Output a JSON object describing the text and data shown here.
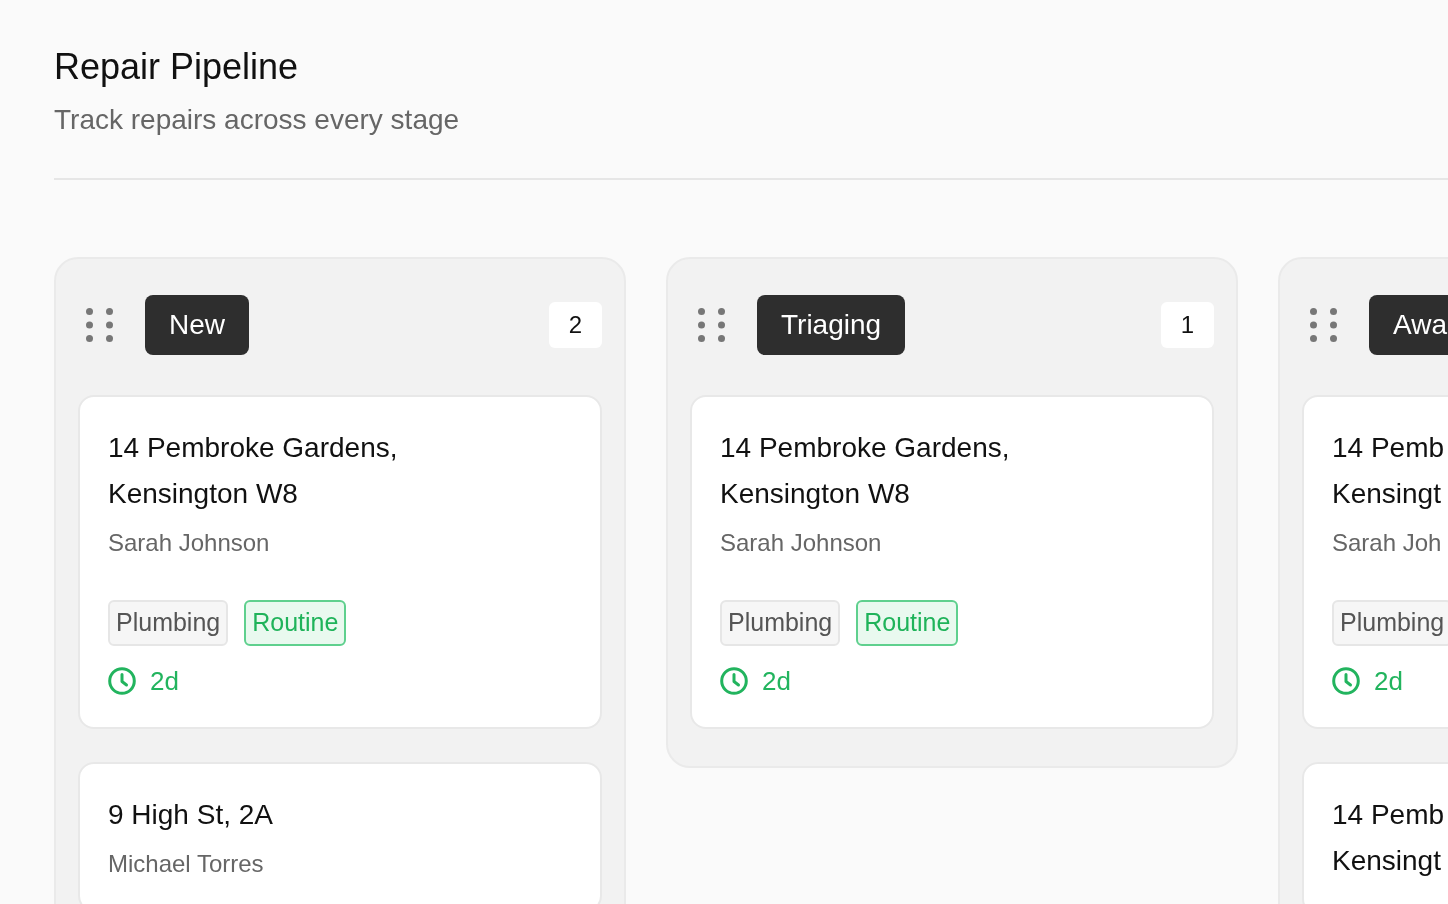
{
  "header": {
    "title": "Repair Pipeline",
    "subtitle": "Track repairs across every stage"
  },
  "columns": [
    {
      "title": "New",
      "count": "2",
      "cards": [
        {
          "address_lines": [
            "14 Pembroke Gardens,",
            "Kensington W8"
          ],
          "contact": "Sarah Johnson",
          "tags": [
            {
              "label": "Plumbing",
              "kind": "category"
            },
            {
              "label": "Routine",
              "kind": "priority"
            }
          ],
          "age": "2d"
        },
        {
          "address_lines": [
            "9 High St, 2A"
          ],
          "contact": "Michael Torres"
        }
      ]
    },
    {
      "title": "Triaging",
      "count": "1",
      "cards": [
        {
          "address_lines": [
            "14 Pembroke Gardens,",
            "Kensington W8"
          ],
          "contact": "Sarah Johnson",
          "tags": [
            {
              "label": "Plumbing",
              "kind": "category"
            },
            {
              "label": "Routine",
              "kind": "priority"
            }
          ],
          "age": "2d"
        }
      ]
    },
    {
      "title": "Awa",
      "cards": [
        {
          "address_lines": [
            "14 Pemb",
            "Kensingt"
          ],
          "contact": "Sarah Joh",
          "tags": [
            {
              "label": "Plumbing",
              "kind": "category"
            }
          ],
          "age": "2d"
        },
        {
          "address_lines": [
            "14 Pemb",
            "Kensingt"
          ]
        }
      ]
    }
  ]
}
